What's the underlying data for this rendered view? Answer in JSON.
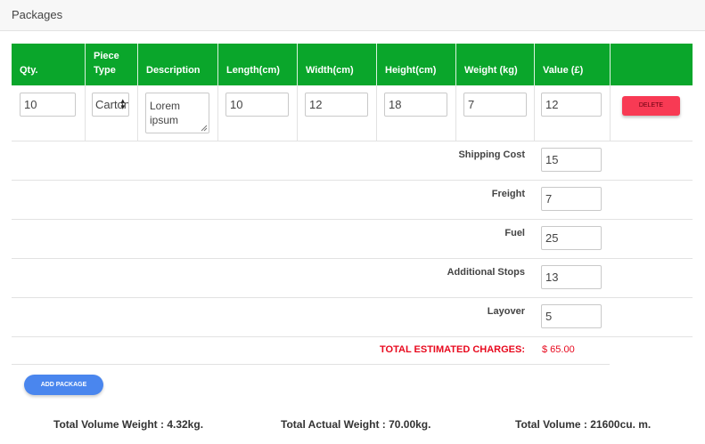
{
  "header": {
    "title": "Packages"
  },
  "table": {
    "columns": [
      "Qty.",
      "Piece Type",
      "Description",
      "Length(cm)",
      "Width(cm)",
      "Height(cm)",
      "Weight (kg)",
      "Value (£)",
      ""
    ],
    "column_lines": {
      "piece_type_1": "Piece",
      "piece_type_2": "Type"
    },
    "row": {
      "qty": "10",
      "piece_type": "Carton",
      "description": "Lorem ipsum",
      "length": "10",
      "width": "12",
      "height": "18",
      "weight": "7",
      "value": "12",
      "delete_label": "DELETE"
    }
  },
  "charges": [
    {
      "label": "Shipping Cost",
      "value": "15"
    },
    {
      "label": "Freight",
      "value": "7"
    },
    {
      "label": "Fuel",
      "value": "25"
    },
    {
      "label": "Additional Stops",
      "value": "13"
    },
    {
      "label": "Layover",
      "value": "5"
    }
  ],
  "total": {
    "label": "TOTAL ESTIMATED CHARGES:",
    "value": "$ 65.00"
  },
  "add_package_label": "ADD PACKAGE",
  "summary": {
    "volume_weight": "Total Volume Weight : 4.32kg.",
    "actual_weight": "Total Actual Weight : 70.00kg.",
    "total_volume": "Total Volume : 21600cu. m."
  },
  "colors": {
    "header_green": "#0aa62b",
    "delete_red": "#f83a54",
    "add_blue": "#4a86ee",
    "total_red": "#e8091e"
  }
}
